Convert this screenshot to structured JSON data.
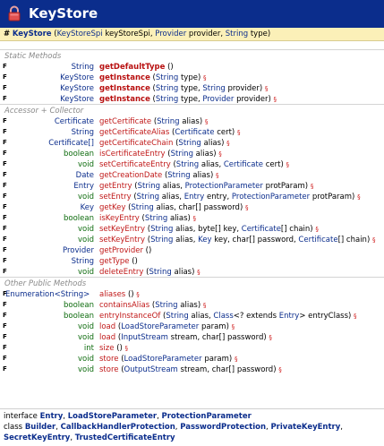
{
  "header": {
    "title": "KeyStore",
    "icon": "lock-icon"
  },
  "ctor": {
    "hash": "#",
    "name": "KeyStore",
    "params": [
      {
        "type": "KeyStoreSpi",
        "name": "keyStoreSpi"
      },
      {
        "type": "Provider",
        "name": "provider"
      },
      {
        "type": "String",
        "name": "type"
      }
    ]
  },
  "sections": {
    "static": "Static Methods",
    "accessor": "Accessor + Collector",
    "other": "Other Public Methods"
  },
  "static_methods": [
    {
      "ret": "String",
      "name": "getDefaultType",
      "params": "()",
      "exc": false
    },
    {
      "ret": "KeyStore",
      "name": "getInstance",
      "params": "(String type)",
      "exc": true
    },
    {
      "ret": "KeyStore",
      "name": "getInstance",
      "params": "(String type, String provider)",
      "exc": true
    },
    {
      "ret": "KeyStore",
      "name": "getInstance",
      "params": "(String type, Provider provider)",
      "exc": true
    }
  ],
  "accessor_methods": [
    {
      "ret": "Certificate",
      "name": "getCertificate",
      "params": "(String alias)",
      "exc": true
    },
    {
      "ret": "String",
      "name": "getCertificateAlias",
      "params": "(Certificate cert)",
      "exc": true
    },
    {
      "ret": "Certificate[]",
      "name": "getCertificateChain",
      "params": "(String alias)",
      "exc": true
    },
    {
      "ret": "boolean",
      "name": "isCertificateEntry",
      "params": "(String alias)",
      "exc": true
    },
    {
      "ret": "void",
      "name": "setCertificateEntry",
      "params": "(String alias, Certificate cert)",
      "exc": true
    },
    {
      "ret": "Date",
      "name": "getCreationDate",
      "params": "(String alias)",
      "exc": true
    },
    {
      "ret": "Entry",
      "name": "getEntry",
      "params": "(String alias, ProtectionParameter protParam)",
      "exc": true
    },
    {
      "ret": "void",
      "name": "setEntry",
      "params": "(String alias, Entry entry, ProtectionParameter protParam)",
      "exc": true
    },
    {
      "ret": "Key",
      "name": "getKey",
      "params": "(String alias, char[] password)",
      "exc": true
    },
    {
      "ret": "boolean",
      "name": "isKeyEntry",
      "params": "(String alias)",
      "exc": true
    },
    {
      "ret": "void",
      "name": "setKeyEntry",
      "params": "(String alias, byte[] key, Certificate[] chain)",
      "exc": true
    },
    {
      "ret": "void",
      "name": "setKeyEntry",
      "params": "(String alias, Key key, char[] password, Certificate[] chain)",
      "exc": true
    },
    {
      "ret": "Provider",
      "name": "getProvider",
      "params": "()",
      "exc": false
    },
    {
      "ret": "String",
      "name": "getType",
      "params": "()",
      "exc": false
    },
    {
      "ret": "void",
      "name": "deleteEntry",
      "params": "(String alias)",
      "exc": true
    }
  ],
  "other_methods": [
    {
      "ret": "Enumeration<String>",
      "name": "aliases",
      "params": "()",
      "exc": true
    },
    {
      "ret": "boolean",
      "name": "containsAlias",
      "params": "(String alias)",
      "exc": true
    },
    {
      "ret": "boolean",
      "name": "entryInstanceOf",
      "params": "(String alias, Class<? extends Entry> entryClass)",
      "exc": true
    },
    {
      "ret": "void",
      "name": "load",
      "params": "(LoadStoreParameter param)",
      "exc": true
    },
    {
      "ret": "void",
      "name": "load",
      "params": "(InputStream stream, char[] password)",
      "exc": true
    },
    {
      "ret": "int",
      "name": "size",
      "params": "()",
      "exc": true
    },
    {
      "ret": "void",
      "name": "store",
      "params": "(LoadStoreParameter param)",
      "exc": true
    },
    {
      "ret": "void",
      "name": "store",
      "params": "(OutputStream stream, char[] password)",
      "exc": true
    }
  ],
  "footer": {
    "interface_kw": "interface",
    "interfaces": [
      "Entry",
      "LoadStoreParameter",
      "ProtectionParameter"
    ],
    "class_kw": "class",
    "classes": [
      "Builder",
      "CallbackHandlerProtection",
      "PasswordProtection",
      "PrivateKeyEntry",
      "SecretKeyEntry",
      "TrustedCertificateEntry"
    ]
  },
  "marker_glyph": "F",
  "exc_glyph": "§",
  "colors": {
    "title_bg": "#0b2d8c",
    "ctor_bg": "#fbf0b8",
    "method": "#c01818",
    "type": "#0b2d8c"
  }
}
